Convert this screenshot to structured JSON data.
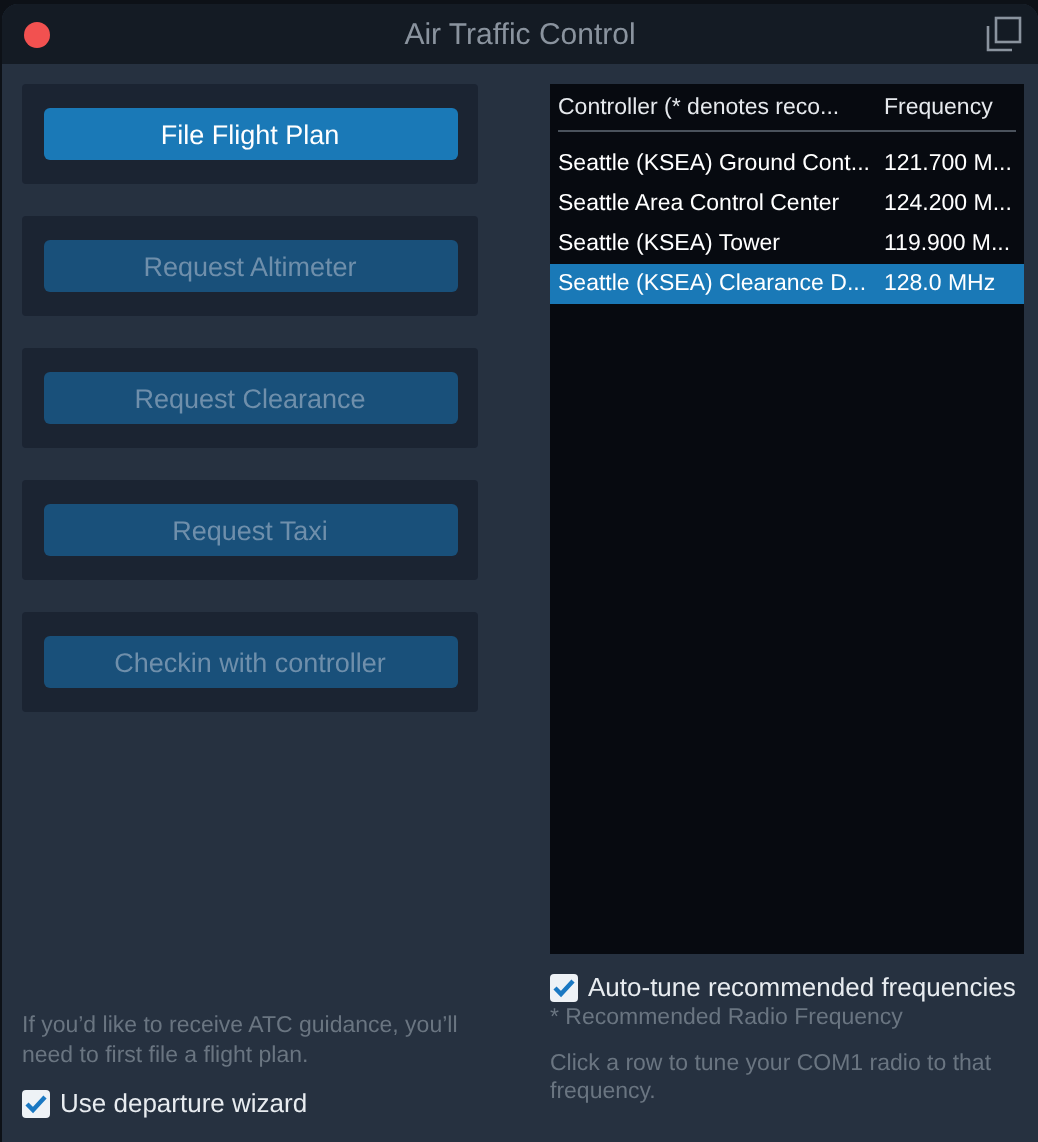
{
  "window": {
    "title": "Air Traffic Control"
  },
  "actions": [
    {
      "label": "File Flight Plan",
      "disabled": false
    },
    {
      "label": "Request Altimeter",
      "disabled": true
    },
    {
      "label": "Request Clearance",
      "disabled": true
    },
    {
      "label": "Request Taxi",
      "disabled": true
    },
    {
      "label": "Checkin with controller",
      "disabled": true
    }
  ],
  "guidance_note": "If you’d like to receive ATC guidance, you’ll need to first file a flight plan.",
  "departure_wizard": {
    "label": "Use departure wizard",
    "checked": true
  },
  "table": {
    "columns": [
      "Controller (* denotes reco...",
      "Frequency"
    ],
    "rows": [
      {
        "controller": "Seattle (KSEA) Ground Cont...",
        "frequency": "121.700 M...",
        "selected": false
      },
      {
        "controller": "Seattle Area Control Center",
        "frequency": "124.200 M...",
        "selected": false
      },
      {
        "controller": "Seattle (KSEA) Tower",
        "frequency": "119.900 M...",
        "selected": false
      },
      {
        "controller": "Seattle (KSEA) Clearance D...",
        "frequency": "128.0 MHz",
        "selected": true
      }
    ]
  },
  "auto_tune": {
    "label": "Auto-tune recommended frequencies",
    "checked": true
  },
  "legend": "* Recommended Radio Frequency",
  "hint": "Click a row to tune your COM1 radio to that frequency."
}
